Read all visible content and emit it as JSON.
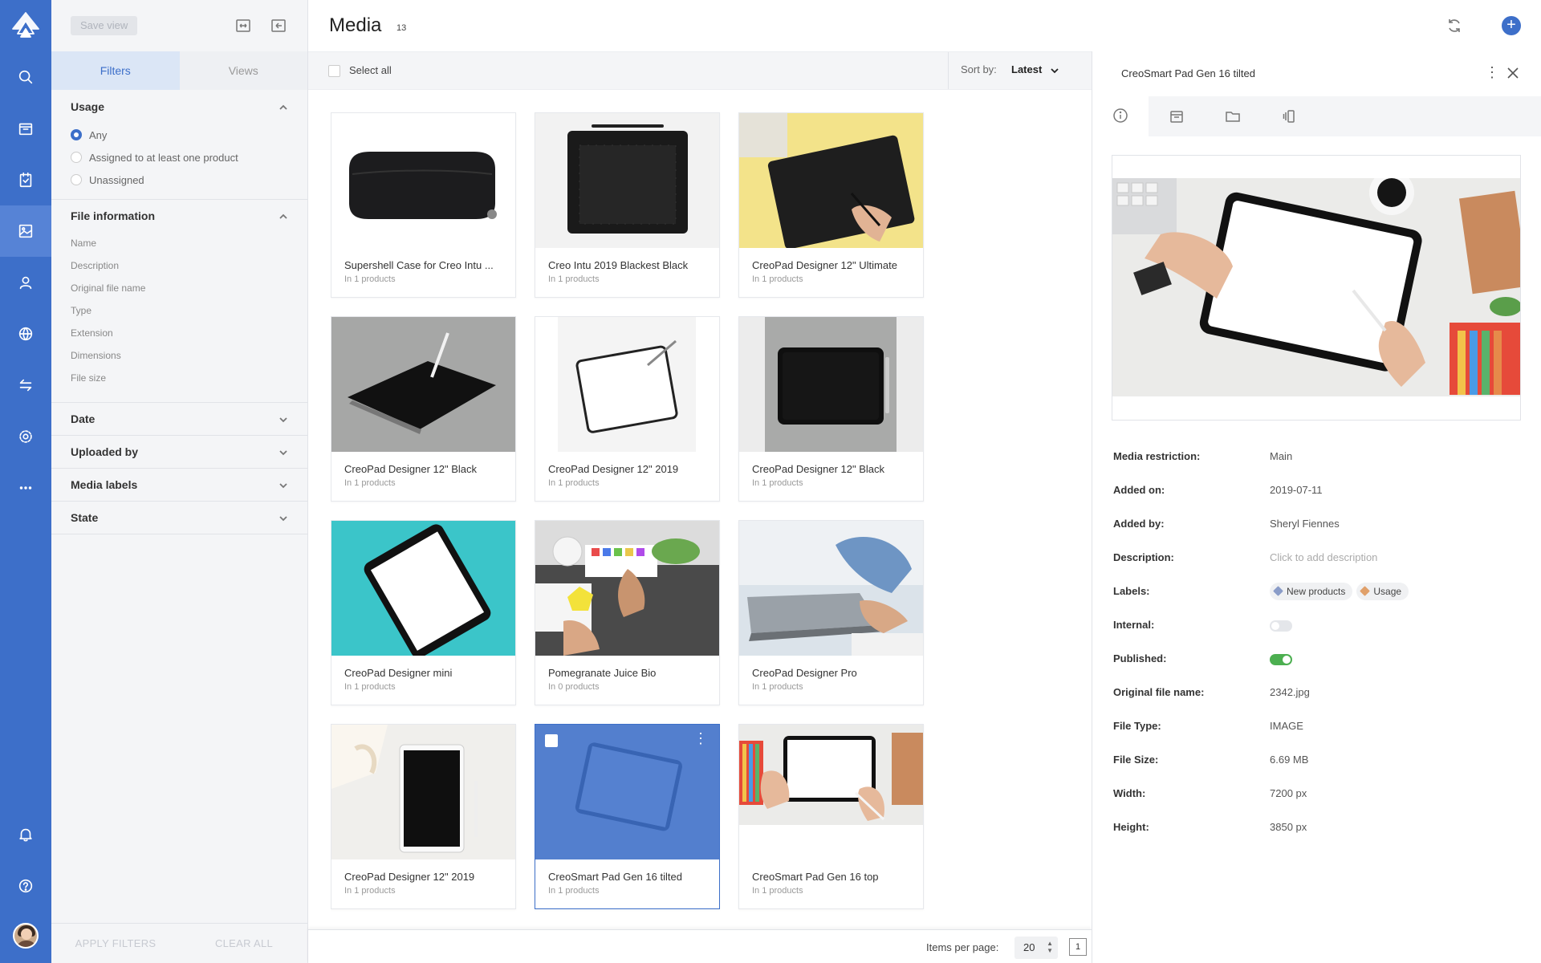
{
  "sidebar_panel": {
    "save_view_label": "Save view",
    "tabs": [
      {
        "label": "Filters",
        "active": true
      },
      {
        "label": "Views",
        "active": false
      }
    ],
    "usage": {
      "title": "Usage",
      "options": [
        {
          "label": "Any",
          "checked": true
        },
        {
          "label": "Assigned to at least one product",
          "checked": false
        },
        {
          "label": "Unassigned",
          "checked": false
        }
      ]
    },
    "file_information": {
      "title": "File information",
      "fields": [
        "Name",
        "Description",
        "Original file name",
        "Type",
        "Extension",
        "Dimensions",
        "File size"
      ]
    },
    "collapsed_sections": [
      "Date",
      "Uploaded by",
      "Media labels",
      "State"
    ],
    "apply_label": "APPLY FILTERS",
    "clear_label": "CLEAR ALL"
  },
  "main": {
    "title": "Media",
    "count": "13",
    "select_all_label": "Select all",
    "sort_label": "Sort by:",
    "sort_value": "Latest",
    "items_per_page_label": "Items per page:",
    "items_per_page_value": "20",
    "current_page": "1",
    "media": [
      {
        "name": "Supershell Case for Creo Intu ...",
        "sub": "In 1 products",
        "thumb": "case"
      },
      {
        "name": "Creo Intu 2019 Blackest Black",
        "sub": "In 1 products",
        "thumb": "tablet-top"
      },
      {
        "name": "CreoPad Designer 12\" Ultimate",
        "sub": "In 1 products",
        "thumb": "tablet-yellow"
      },
      {
        "name": "CreoPad Designer 12\" Black",
        "sub": "In 1 products",
        "thumb": "tablet-gray-pen"
      },
      {
        "name": "CreoPad Designer 12\" 2019",
        "sub": "In 1 products",
        "thumb": "tablet-white"
      },
      {
        "name": "CreoPad Designer 12\" Black",
        "sub": "In 1 products",
        "thumb": "tablet-gray-front"
      },
      {
        "name": "CreoPad Designer mini",
        "sub": "In 1 products",
        "thumb": "tablet-teal"
      },
      {
        "name": "Pomegranate Juice Bio",
        "sub": "In 0 products",
        "thumb": "desk-draw"
      },
      {
        "name": "CreoPad Designer Pro",
        "sub": "In 1 products",
        "thumb": "laptop"
      },
      {
        "name": "CreoPad Designer 12\" 2019",
        "sub": "In 1 products",
        "thumb": "ipad-black"
      },
      {
        "name": "CreoSmart Pad Gen 16 tilted",
        "sub": "In 1 products",
        "thumb": "tilted",
        "selected": true
      },
      {
        "name": "CreoSmart Pad Gen 16 top",
        "sub": "In 1 products",
        "thumb": "top"
      }
    ]
  },
  "detail": {
    "title": "CreoSmart Pad Gen 16 tilted",
    "properties": [
      {
        "key": "Media restriction:",
        "value": "Main"
      },
      {
        "key": "Added on:",
        "value": "2019-07-11"
      },
      {
        "key": "Added by:",
        "value": "Sheryl Fiennes"
      },
      {
        "key": "Description:",
        "value": "Click to add description",
        "placeholder": true
      },
      {
        "key": "Labels:",
        "labels": [
          {
            "label": "New products",
            "color": "#8a9cc8"
          },
          {
            "label": "Usage",
            "color": "#e0a06a"
          }
        ]
      },
      {
        "key": "Internal:",
        "toggle": false
      },
      {
        "key": "Published:",
        "toggle": true
      },
      {
        "key": "Original file name:",
        "value": "2342.jpg"
      },
      {
        "key": "File Type:",
        "value": "IMAGE"
      },
      {
        "key": "File Size:",
        "value": "6.69 MB"
      },
      {
        "key": "Width:",
        "value": "7200 px"
      },
      {
        "key": "Height:",
        "value": "3850 px"
      }
    ]
  },
  "colors": {
    "brand": "#3d6fc9",
    "published": "#4caf50"
  }
}
